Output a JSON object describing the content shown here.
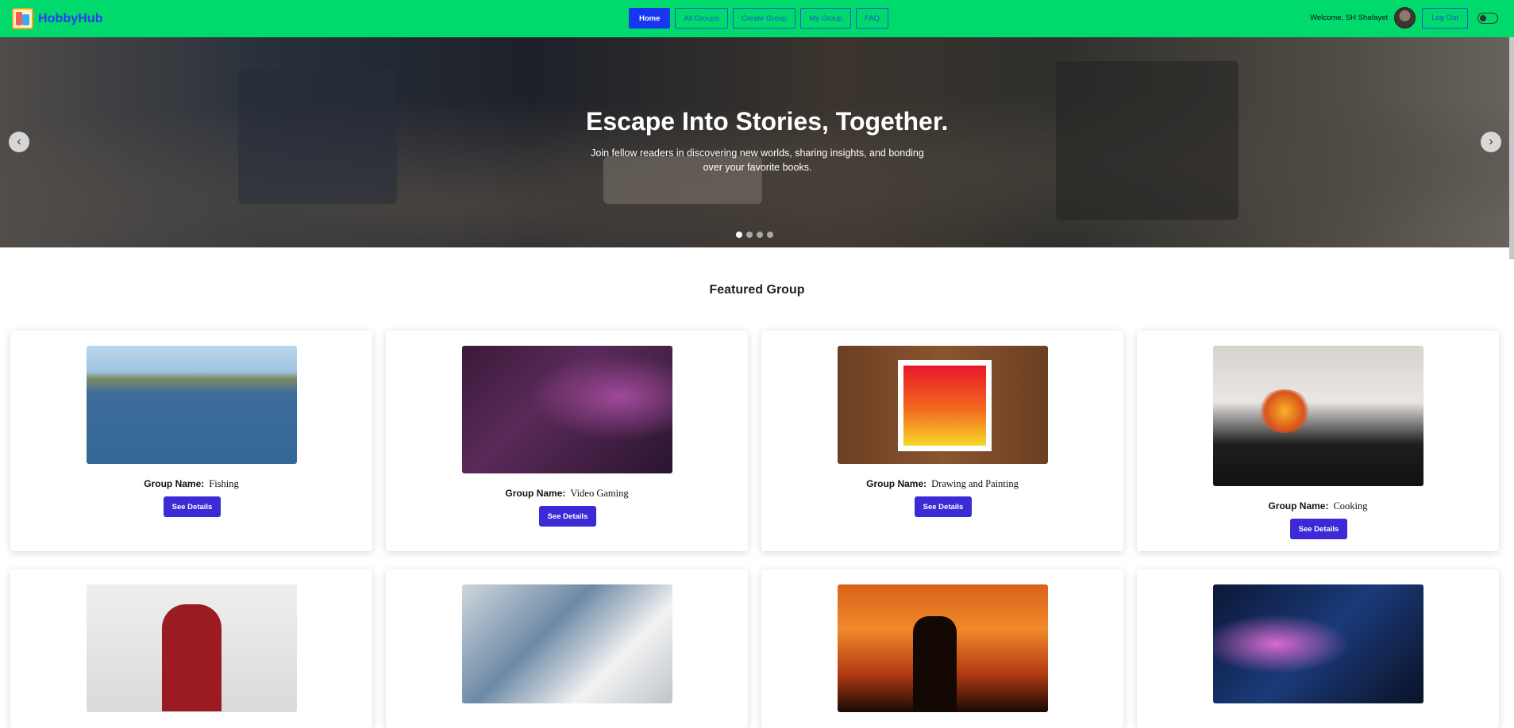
{
  "navbar": {
    "brand": "HobbyHub",
    "links": [
      {
        "label": "Home",
        "active": true
      },
      {
        "label": "All Groups",
        "active": false
      },
      {
        "label": "Create Group",
        "active": false
      },
      {
        "label": "My Group",
        "active": false
      },
      {
        "label": "FAQ",
        "active": false
      }
    ],
    "welcome": "Welcome, SH Shafayet",
    "logout_label": "Log Out"
  },
  "hero": {
    "title": "Escape Into Stories, Together.",
    "subtitle": "Join fellow readers in discovering new worlds, sharing insights, and bonding over your favorite books.",
    "prev_icon": "‹",
    "next_icon": "›",
    "slide_count": 4,
    "active_slide": 1
  },
  "featured": {
    "title": "Featured Group",
    "group_label": "Group Name:",
    "details_label": "See Details",
    "groups": [
      {
        "name": "Fishing",
        "image": "fishing-image"
      },
      {
        "name": "Video Gaming",
        "image": "video-gaming-image"
      },
      {
        "name": "Drawing and Painting",
        "image": "painting-image"
      },
      {
        "name": "Cooking",
        "image": "cooking-image"
      },
      {
        "name": "",
        "image": "reading-image"
      },
      {
        "name": "",
        "image": "writing-image"
      },
      {
        "name": "",
        "image": "photography-image"
      },
      {
        "name": "",
        "image": "gaming-image"
      }
    ]
  },
  "colors": {
    "navbar": "#00d96b",
    "brand": "#2a3cf0",
    "active_nav": "#1736f0",
    "button": "#3c2ad6"
  }
}
